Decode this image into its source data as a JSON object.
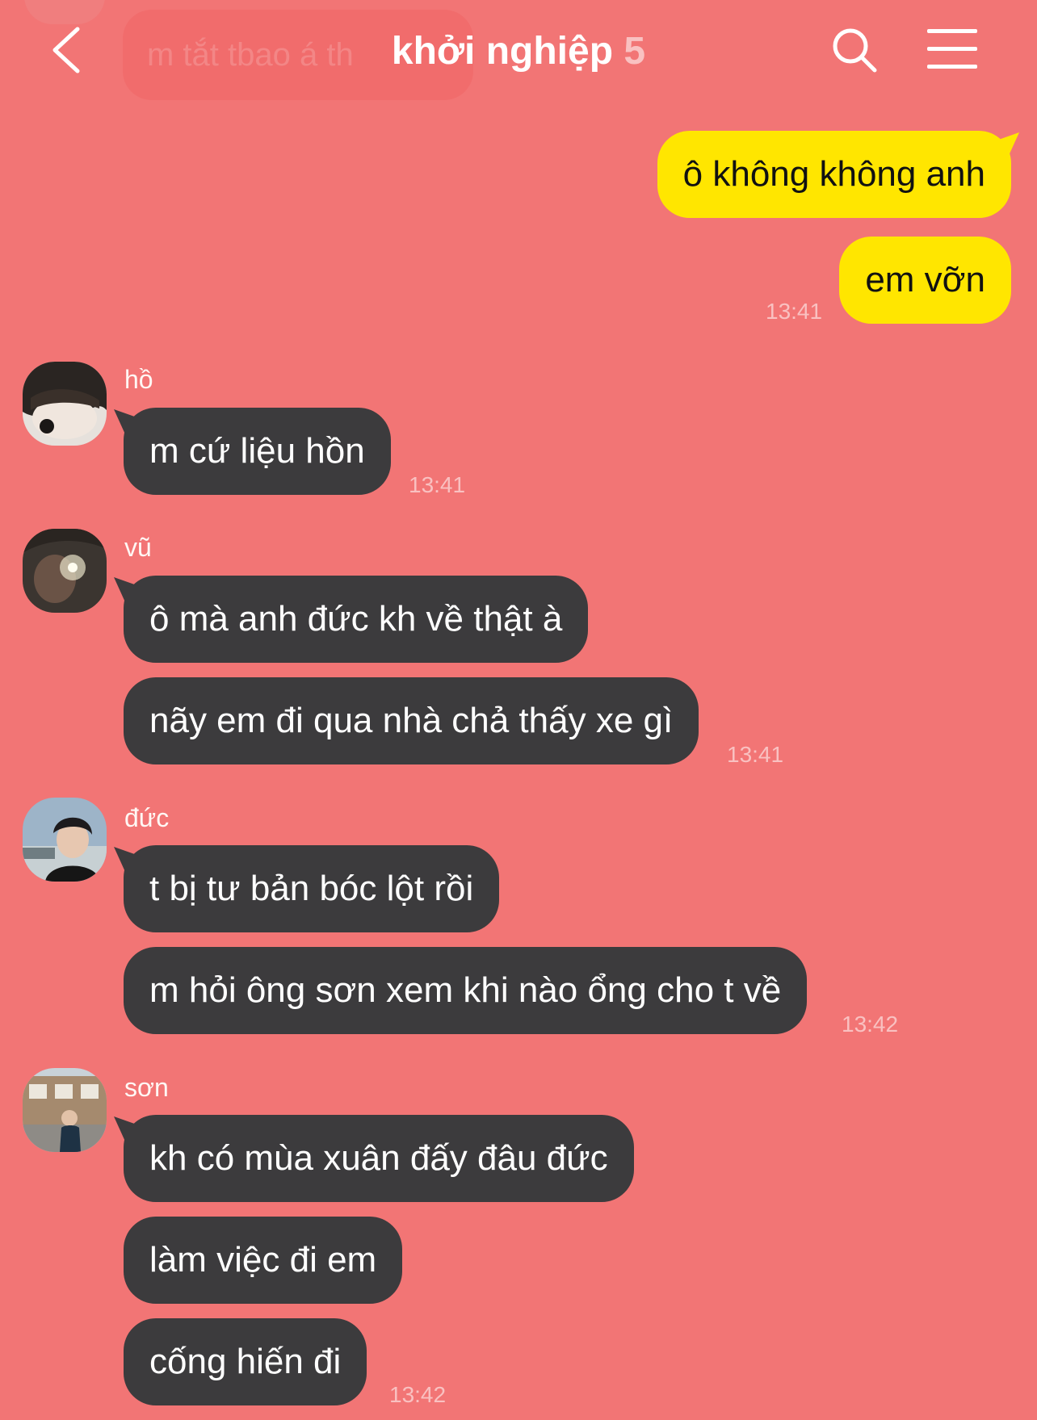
{
  "header": {
    "title": "khởi nghiệp",
    "member_count": "5",
    "ghost_text": "m tắt tbao á th"
  },
  "icons": {
    "back": "chevron-left-icon",
    "search": "search-icon",
    "menu": "hamburger-menu-icon"
  },
  "colors": {
    "background": "#f27575",
    "incoming_bubble": "#3c3b3d",
    "outgoing_bubble": "#ffe600"
  },
  "messages": {
    "outgoing": [
      {
        "text": "ô không không anh"
      },
      {
        "text": "em vỡn",
        "time": "13:41"
      }
    ],
    "groups": [
      {
        "sender": "hồ",
        "messages": [
          {
            "text": "m cứ liệu hồn"
          }
        ],
        "time": "13:41"
      },
      {
        "sender": "vũ",
        "messages": [
          {
            "text": "ô mà anh đức kh về thật à"
          },
          {
            "text": "nãy em đi qua nhà chả thấy xe gì"
          }
        ],
        "time": "13:41"
      },
      {
        "sender": "đức",
        "messages": [
          {
            "text": "t bị tư bản bóc lột rồi"
          },
          {
            "text": "m hỏi ông sơn xem khi nào ổng cho t về"
          }
        ],
        "time": "13:42"
      },
      {
        "sender": "sơn",
        "messages": [
          {
            "text": "kh có mùa xuân đấy đâu đức"
          },
          {
            "text": "làm việc đi em"
          },
          {
            "text": "cống hiến đi"
          }
        ],
        "time": "13:42"
      }
    ]
  }
}
